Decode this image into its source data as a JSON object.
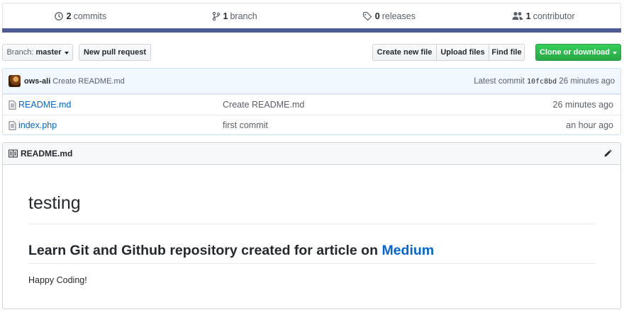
{
  "summary": {
    "commits": {
      "count": "2",
      "label": "commits",
      "icon": "history-icon"
    },
    "branches": {
      "count": "1",
      "label": "branch",
      "icon": "git-branch-icon"
    },
    "releases": {
      "count": "0",
      "label": "releases",
      "icon": "tag-icon"
    },
    "contributors": {
      "count": "1",
      "label": "contributor",
      "icon": "people-icon"
    },
    "language_color": "#4f5d95"
  },
  "toolbar": {
    "branch_prefix": "Branch:",
    "branch_name": "master",
    "new_pr_label": "New pull request",
    "create_file_label": "Create new file",
    "upload_files_label": "Upload files",
    "find_file_label": "Find file",
    "clone_label": "Clone or download",
    "clone_color": "#28a745"
  },
  "latest_commit": {
    "author": "ows-ali",
    "message": "Create README.md",
    "prefix": "Latest commit",
    "sha": "10fc8bd",
    "age": "26 minutes ago"
  },
  "files": [
    {
      "name": "README.md",
      "message": "Create README.md",
      "age": "26 minutes ago",
      "icon": "file-icon"
    },
    {
      "name": "index.php",
      "message": "first commit",
      "age": "an hour ago",
      "icon": "file-icon"
    }
  ],
  "readme": {
    "header_title": "README.md",
    "h1": "testing",
    "h2_text": "Learn Git and Github repository created for article on",
    "h2_link": "Medium",
    "paragraph": "Happy Coding!",
    "link_color": "#0366d6"
  }
}
